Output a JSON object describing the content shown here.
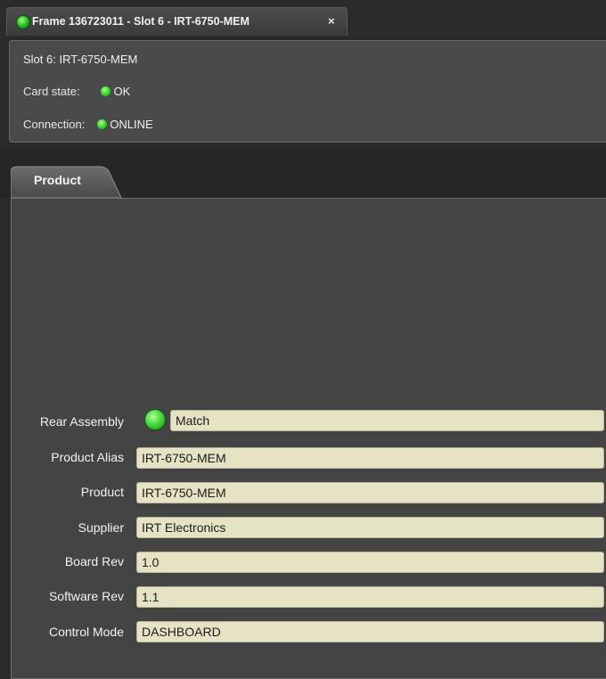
{
  "window_tab": {
    "title": "Frame 136723011 - Slot 6 - IRT-6750-MEM",
    "close_icon": "×",
    "status_color": "#2dbf27"
  },
  "header": {
    "slot": "Slot 6: IRT-6750-MEM",
    "card_state_label": "Card state:",
    "card_state_value": "OK",
    "connection_label": "Connection:",
    "connection_value": "ONLINE",
    "led_color": "#2fd12a"
  },
  "tabs": [
    {
      "label": "Product",
      "active": true
    }
  ],
  "product": {
    "fields": [
      {
        "label": "Rear Assembly",
        "value": "Match",
        "indicator": "green-led"
      },
      {
        "label": "Product Alias",
        "value": "IRT-6750-MEM"
      },
      {
        "label": "Product",
        "value": "IRT-6750-MEM"
      },
      {
        "label": "Supplier",
        "value": "IRT Electronics"
      },
      {
        "label": "Board Rev",
        "value": "1.0"
      },
      {
        "label": "Software Rev",
        "value": "1.1"
      },
      {
        "label": "Control Mode",
        "value": "DASHBOARD"
      }
    ]
  },
  "colors": {
    "field_bg": "#e6e3c4",
    "panel_bg": "#444444",
    "window_bg": "#2a2a2a"
  }
}
